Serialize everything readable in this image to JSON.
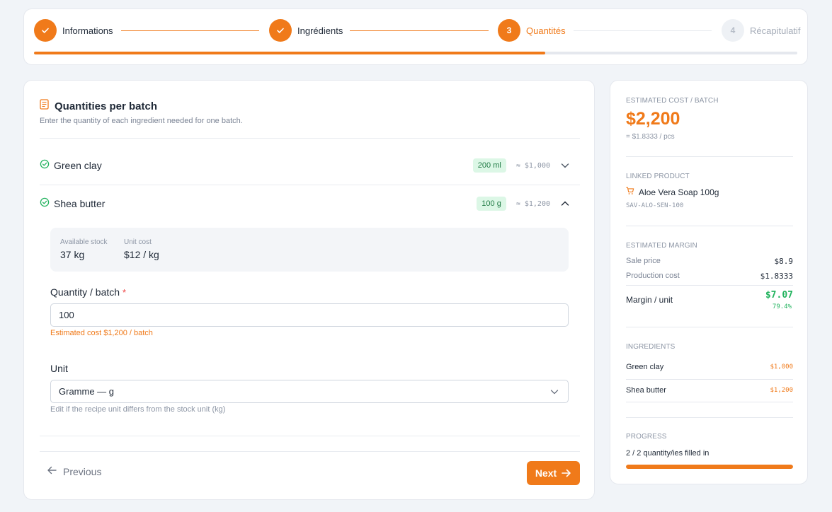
{
  "stepper": {
    "steps": [
      {
        "number": "1",
        "label": "Informations",
        "state": "done"
      },
      {
        "number": "2",
        "label": "Ingrédients",
        "state": "done"
      },
      {
        "number": "3",
        "label": "Quantités",
        "state": "active"
      },
      {
        "number": "4",
        "label": "Récapitulatif",
        "state": "todo"
      }
    ],
    "progress_fraction": 0.67
  },
  "main": {
    "title": "Quantities per batch",
    "subtitle": "Enter the quantity of each ingredient needed for one batch.",
    "ingredients": [
      {
        "name": "Green clay",
        "badge": "200 ml",
        "approx": "≈ $1,000",
        "expanded": false
      },
      {
        "name": "Shea butter",
        "badge": "100 g",
        "approx": "≈ $1,200",
        "expanded": true
      }
    ],
    "details": {
      "stock_label": "Available stock",
      "stock_value": "37 kg",
      "unit_cost_label": "Unit cost",
      "unit_cost_value": "$12 / kg"
    },
    "quantity_field": {
      "label": "Quantity / batch",
      "required_mark": "*",
      "value": "100",
      "hint": "Estimated cost $1,200 / batch"
    },
    "unit_field": {
      "label": "Unit",
      "value": "Gramme — g",
      "hint": "Edit if the recipe unit differs from the stock unit (kg)"
    },
    "previous_label": "Previous",
    "next_label": "Next"
  },
  "summary": {
    "cost_label": "Estimated cost / batch",
    "cost_value": "$2,200",
    "per_piece": "= $1.8333 / pcs",
    "product_label": "Linked product",
    "product_name": "Aloe Vera Soap 100g",
    "product_sku": "SAV-ALO-SEN-100",
    "margin_label": "Estimated margin",
    "sale_price_label": "Sale price",
    "sale_price_value": "$8.9",
    "production_cost_label": "Production cost",
    "production_cost_value": "$1.8333",
    "margin_unit_label": "Margin / unit",
    "margin_unit_value": "$7.07",
    "margin_percent": "79.4%",
    "ingredients_label": "Ingredients",
    "ingredients": [
      {
        "name": "Green clay",
        "cost": "$1,000"
      },
      {
        "name": "Shea butter",
        "cost": "$1,200"
      }
    ],
    "progress_label": "Progress",
    "progress_text": "2 / 2 quantity/ies filled in",
    "progress_fraction": 1.0
  },
  "colors": {
    "accent": "#f07a1a",
    "success": "#22b35e",
    "badge_bg": "#dcf7e6"
  }
}
